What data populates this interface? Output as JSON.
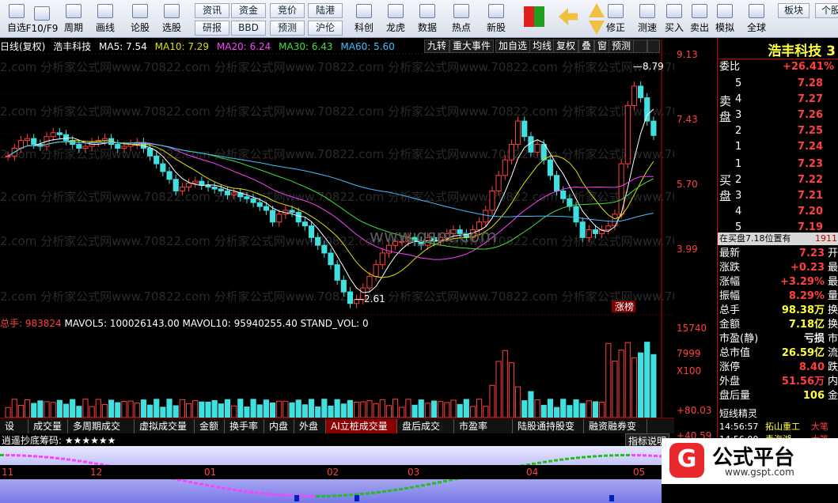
{
  "toolbar": {
    "items": [
      {
        "label": "自选",
        "icon": "list-icon"
      },
      {
        "label": "F10/F9",
        "icon": "info-icon"
      },
      {
        "label": "周期",
        "icon": "clock-icon"
      },
      {
        "label": "画线",
        "icon": "pencil-icon"
      },
      {
        "label": "论股",
        "icon": "chat-icon"
      },
      {
        "label": "选股",
        "icon": "gauge-icon"
      },
      {
        "label": "科创",
        "icon": "chart-icon"
      },
      {
        "label": "龙虎",
        "icon": "dragon-icon"
      },
      {
        "label": "数据",
        "icon": "pe-icon"
      },
      {
        "label": "热点",
        "icon": "fire-icon"
      },
      {
        "label": "新股",
        "icon": "new-icon"
      },
      {
        "label": "修正",
        "icon": "refresh-icon"
      },
      {
        "label": "测速",
        "icon": "stopwatch-icon"
      },
      {
        "label": "买入",
        "icon": "buy-icon"
      },
      {
        "label": "卖出",
        "icon": "sell-icon"
      },
      {
        "label": "模拟",
        "icon": "hammer-icon"
      },
      {
        "label": "全球",
        "icon": "globe-icon"
      }
    ],
    "small_buttons": [
      "资讯",
      "资金",
      "竞价",
      "陆港",
      "研报",
      "BBD",
      "预测",
      "沪伦"
    ],
    "right_buttons": [
      "板块",
      "个股"
    ]
  },
  "title": {
    "period": "日线(复权)",
    "name": "浩丰科技",
    "ma5": "MA5: 7.54",
    "ma10": "MA10: 7.29",
    "ma20": "MA20: 6.24",
    "ma30": "MA30: 6.43",
    "ma60": "MA60: 5.60"
  },
  "title_tags": [
    "九转",
    "重大事件",
    "加自选",
    "均线",
    "复权",
    "叠",
    "窗",
    "预测"
  ],
  "price_axis": [
    "9.13",
    "7.43",
    "5.70",
    "3.99"
  ],
  "annotations": {
    "high": "8.79",
    "low": "2.61",
    "zhangbang": "涨榜",
    "watermark": "www.gspt.com",
    "watermark_site": "2.com 分析家公式网www.70822.com 分析家公式网www.70822.com 分析家公式网www.70822.com 分析家公式网www.70822.com 分析家公式网www.70822.com"
  },
  "volume": {
    "label": "总手: 983824",
    "mavol5": "MAVOL5: 100026143.00",
    "mavol10": "MAVOL10: 95940255.40",
    "stand": "STAND_VOL: 0",
    "axis": [
      "15740",
      "7999",
      "X100"
    ]
  },
  "tabs": [
    "设置",
    "成交量",
    "多周期成交量",
    "虚拟成交量",
    "金额",
    "换手率",
    "内盘",
    "外盘",
    "AI立桩成交量",
    "盘后成交量",
    "市盈率(ttm)",
    "陆股通持股变化",
    "融资融券变化"
  ],
  "indicator": {
    "label": "逍遥抄底筹码: ★★★★★★",
    "help": "指标说明",
    "axis": [
      "+80.03",
      "+40.59"
    ]
  },
  "date_axis": [
    "11",
    "12",
    "01",
    "02",
    "03",
    "04",
    "05"
  ],
  "right": {
    "stock": "浩丰科技 3",
    "weibi_label": "委比",
    "weibi_value": "+26.41%",
    "sell_label": "卖盘",
    "buy_label": "买盘",
    "sells": [
      {
        "n": "5",
        "p": "7.28"
      },
      {
        "n": "4",
        "p": "7.27"
      },
      {
        "n": "3",
        "p": "7.26"
      },
      {
        "n": "2",
        "p": "7.25"
      },
      {
        "n": "1",
        "p": "7.24"
      }
    ],
    "buys": [
      {
        "n": "1",
        "p": "7.23"
      },
      {
        "n": "2",
        "p": "7.22"
      },
      {
        "n": "3",
        "p": "7.21"
      },
      {
        "n": "4",
        "p": "7.20"
      },
      {
        "n": "5",
        "p": "7.19"
      }
    ],
    "buy_position": "在买盘7.18位置有",
    "buy_position_val": "1911",
    "stats": [
      {
        "l": "最新",
        "v": "7.23",
        "x": "开"
      },
      {
        "l": "涨跌",
        "v": "+0.23",
        "x": "最"
      },
      {
        "l": "涨幅",
        "v": "+3.29%",
        "x": "最"
      },
      {
        "l": "振幅",
        "v": "8.29%",
        "x": "量"
      },
      {
        "l": "总手",
        "v": "98.38万",
        "x": "换"
      },
      {
        "l": "金额",
        "v": "7.18亿",
        "x": "换"
      },
      {
        "l": "市盈(静)",
        "v": "亏损",
        "x": "市"
      },
      {
        "l": "总市值",
        "v": "26.59亿",
        "x": "流"
      },
      {
        "l": "涨停",
        "v": "8.40",
        "x": "跌"
      },
      {
        "l": "外盘",
        "v": "51.56万",
        "x": "内"
      },
      {
        "l": "盘后量",
        "v": "106",
        "x": "金"
      }
    ],
    "short_title": "短线精灵",
    "short": [
      {
        "t": "14:56:57",
        "n": "拓山重工",
        "x": "大笔"
      },
      {
        "t": "14:56:00",
        "n": "青海湖",
        "x": "大笔"
      }
    ]
  },
  "logo": {
    "text": "公式平台",
    "url": "www.gspt.com"
  }
}
